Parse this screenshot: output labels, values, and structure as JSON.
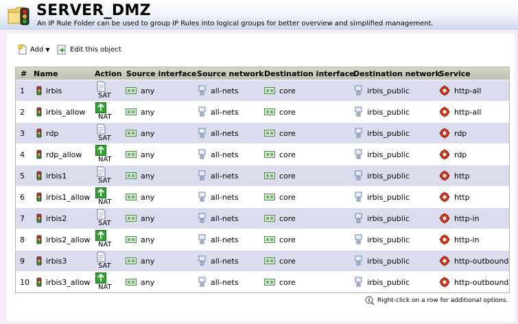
{
  "header": {
    "title": "SERVER_DMZ",
    "subtitle": "An IP Rule Folder can be used to group IP Rules into logical groups for better overview and simplified management."
  },
  "toolbar": {
    "add_label": "Add",
    "edit_label": "Edit this object"
  },
  "table": {
    "columns": [
      "#",
      "Name",
      "Action",
      "Source interface",
      "Source network",
      "Destination interface",
      "Destination network",
      "Service"
    ],
    "rows": [
      {
        "num": "1",
        "name": "irbis",
        "action": "SAT",
        "src_if": "any",
        "src_net": "all-nets",
        "dst_if": "core",
        "dst_net": "irbis_public",
        "service": "http-all"
      },
      {
        "num": "2",
        "name": "irbis_allow",
        "action": "NAT",
        "src_if": "any",
        "src_net": "all-nets",
        "dst_if": "core",
        "dst_net": "irbis_public",
        "service": "http-all"
      },
      {
        "num": "3",
        "name": "rdp",
        "action": "SAT",
        "src_if": "any",
        "src_net": "all-nets",
        "dst_if": "core",
        "dst_net": "irbis_public",
        "service": "rdp"
      },
      {
        "num": "4",
        "name": "rdp_allow",
        "action": "NAT",
        "src_if": "any",
        "src_net": "all-nets",
        "dst_if": "core",
        "dst_net": "irbis_public",
        "service": "rdp"
      },
      {
        "num": "5",
        "name": "irbis1",
        "action": "SAT",
        "src_if": "any",
        "src_net": "all-nets",
        "dst_if": "core",
        "dst_net": "irbis_public",
        "service": "http"
      },
      {
        "num": "6",
        "name": "irbis1_allow",
        "action": "NAT",
        "src_if": "any",
        "src_net": "all-nets",
        "dst_if": "core",
        "dst_net": "irbis_public",
        "service": "http"
      },
      {
        "num": "7",
        "name": "irbis2",
        "action": "SAT",
        "src_if": "any",
        "src_net": "all-nets",
        "dst_if": "core",
        "dst_net": "irbis_public",
        "service": "http-in"
      },
      {
        "num": "8",
        "name": "irbis2_allow",
        "action": "NAT",
        "src_if": "any",
        "src_net": "all-nets",
        "dst_if": "core",
        "dst_net": "irbis_public",
        "service": "http-in"
      },
      {
        "num": "9",
        "name": "irbis3",
        "action": "SAT",
        "src_if": "any",
        "src_net": "all-nets",
        "dst_if": "core",
        "dst_net": "irbis_public",
        "service": "http-outbound"
      },
      {
        "num": "10",
        "name": "irbis3_allow",
        "action": "NAT",
        "src_if": "any",
        "src_net": "all-nets",
        "dst_if": "core",
        "dst_net": "irbis_public",
        "service": "http-outbound"
      }
    ]
  },
  "hint": "Right-click on a row for additional options.",
  "icons": {
    "header": "folder-traffic-light-icon",
    "add": "new-document-icon",
    "edit": "edit-object-icon",
    "rule": "traffic-light-icon",
    "sat": "sat-document-icon",
    "nat": "nat-green-icon",
    "interface": "interface-card-icon",
    "network": "network-host-icon",
    "service": "service-gear-icon",
    "hint": "info-icon"
  },
  "colors": {
    "row_alt": "#dcdcef",
    "header_bg": "#c8c9b8",
    "nat_green": "#2fa52f",
    "service_red": "#d23a1e"
  }
}
